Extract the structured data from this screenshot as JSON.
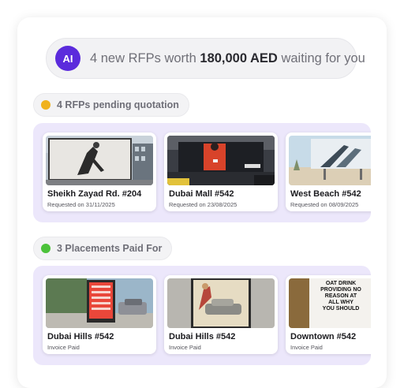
{
  "banner": {
    "avatar_text": "AI",
    "message_prefix": "4 new RFPs worth",
    "message_amount": "180,000 AED",
    "message_suffix": "waiting for you"
  },
  "sections": [
    {
      "label": "4 RFPs pending quotation",
      "dot_color": "#f0b21d",
      "cards": [
        {
          "title": "Sheikh Zayad Rd. #204",
          "subtitle": "Requested on 31/11/2025",
          "image": "billboard-dancer"
        },
        {
          "title": "Dubai Mall #542",
          "subtitle": "Requested on 23/08/2025",
          "image": "billboard-street-night"
        },
        {
          "title": "West Beach #542",
          "subtitle": "Requested on 08/09/2025",
          "image": "billboard-beach"
        }
      ]
    },
    {
      "label": "3 Placements Paid For",
      "dot_color": "#4cc23a",
      "cards": [
        {
          "title": "Dubai Hills #542",
          "subtitle": "Invoice Paid",
          "image": "poster-street-red"
        },
        {
          "title": "Dubai Hills #542",
          "subtitle": "Invoice Paid",
          "image": "poster-vintage-car"
        },
        {
          "title": "Downtown #542",
          "subtitle": "Invoice Paid",
          "image": "poster-text",
          "poster_text": "OAT DRINK PROVIDING NO REASON AT ALL WHY YOU SHOULD"
        }
      ]
    }
  ],
  "colors": {
    "accent": "#5b2bdc",
    "strip_bg": "#ece7fb",
    "pending": "#f0b21d",
    "paid": "#4cc23a"
  }
}
